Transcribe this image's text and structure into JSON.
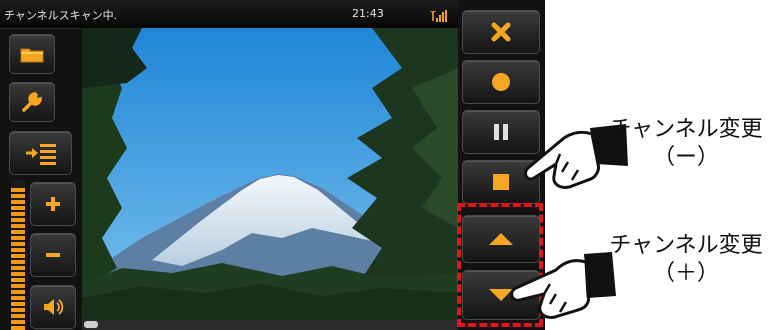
{
  "status_bar": {
    "title": "チャンネルスキャン中.",
    "time": "21:43",
    "signal_label": "T.all"
  },
  "icons": {
    "folder": "folder-icon",
    "settings": "wrench-icon",
    "list": "playlist-icon",
    "volume_up": "plus-icon",
    "volume_down": "minus-icon",
    "speaker": "speaker-icon",
    "close": "close-icon",
    "record": "record-icon",
    "pause": "pause-icon",
    "stop": "stop-icon",
    "channel_up": "triangle-up-icon",
    "channel_down": "triangle-down-icon"
  },
  "colors": {
    "accent": "#f29a18",
    "highlight": "#e2141c",
    "device_bg": "#121212"
  },
  "volume_level": 0.95,
  "seek_position": 0.0,
  "annotations": {
    "channel_minus": {
      "line1": "チャンネル変更",
      "line2": "（ー）"
    },
    "channel_plus": {
      "line1": "チャンネル変更",
      "line2": "（＋）"
    }
  }
}
